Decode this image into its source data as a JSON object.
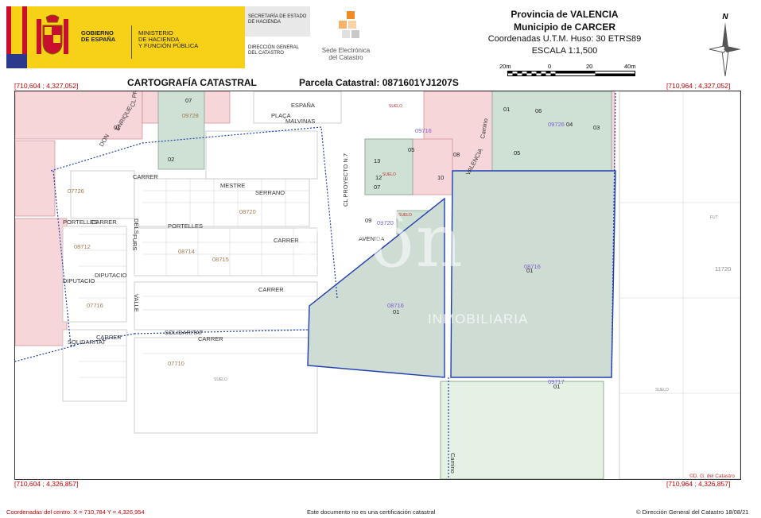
{
  "header": {
    "gobierno": [
      "GOBIERNO",
      "DE ESPAÑA"
    ],
    "ministerio": [
      "MINISTERIO",
      "DE HACIENDA",
      "Y FUNCIÓN PÚBLICA"
    ],
    "secretaria": [
      "SECRETARÍA DE ESTADO",
      "DE HACIENDA"
    ],
    "direccion": [
      "DIRECCIÓN GENERAL",
      "DEL CATASTRO"
    ],
    "sede": [
      "Sede Electrónica",
      "del Catastro"
    ],
    "provincia": "Provincia de VALENCIA",
    "municipio": "Municipio de CARCER",
    "coordenadas": "Coordenadas U.T.M. Huso: 30 ETRS89",
    "escala": "ESCALA 1:1,500",
    "scale_ticks": [
      "20m",
      "0",
      "20",
      "40m"
    ],
    "north_label": "N"
  },
  "titles": {
    "cartografia": "CARTOGRAFÍA CATASTRAL",
    "parcela": "Parcela Catastral: 0871601YJ1207S"
  },
  "corners": {
    "top_left": "[710,604 ; 4,327,052]",
    "top_right": "[710,964 ; 4,327,052]",
    "bottom_left": "[710,604 ; 4,326,857]",
    "bottom_right": "[710,964 ; 4,326,857]"
  },
  "map": {
    "watermark": "rsôn",
    "watermark_sub": "INMOBILIARIA",
    "copyright_in_map": "©D. G. del Catastro",
    "streets": [
      "PLAÇA",
      "ESPAÑA",
      "MALVINAS",
      "CARRER",
      "MESTRE",
      "SERRANO",
      "PORTELLES",
      "CARRER",
      "PORTELLES",
      "CARRER",
      "DIPUTACIO",
      "DIPUTACIO",
      "CARRER",
      "SOLIDARITAT",
      "CARRER",
      "SOLIDARITAT",
      "CARRER",
      "DELS",
      "FURS",
      "VALLE",
      "DON",
      "ENRIQUE",
      "CL PROYECTO N.5",
      "CL PROYECTO N.7",
      "AVENIDA",
      "VALENCIA",
      "Camino"
    ],
    "parcels": [
      "07",
      "02",
      "01",
      "06",
      "03",
      "04",
      "05",
      "13",
      "12",
      "10",
      "07",
      "08",
      "05",
      "09",
      "01",
      "01",
      "01",
      "01"
    ],
    "blocks": [
      "09728",
      "07726",
      "08720",
      "08712",
      "08715",
      "07716",
      "07710",
      "09726",
      "09720",
      "09716",
      "08716",
      "08716",
      "09717",
      "11720",
      "08714"
    ],
    "labels_suelo": [
      "SUELO",
      "SUELO",
      "SUELO",
      "SUELO",
      "SUELO",
      "FUT"
    ]
  },
  "footer": {
    "centro": "Coordenadas del centro: X = 710,784 Y = 4,326,954",
    "aviso": "Este documento no es una certificación catastral",
    "copyright": "© Dirección General del Catastro 18/08/21"
  }
}
